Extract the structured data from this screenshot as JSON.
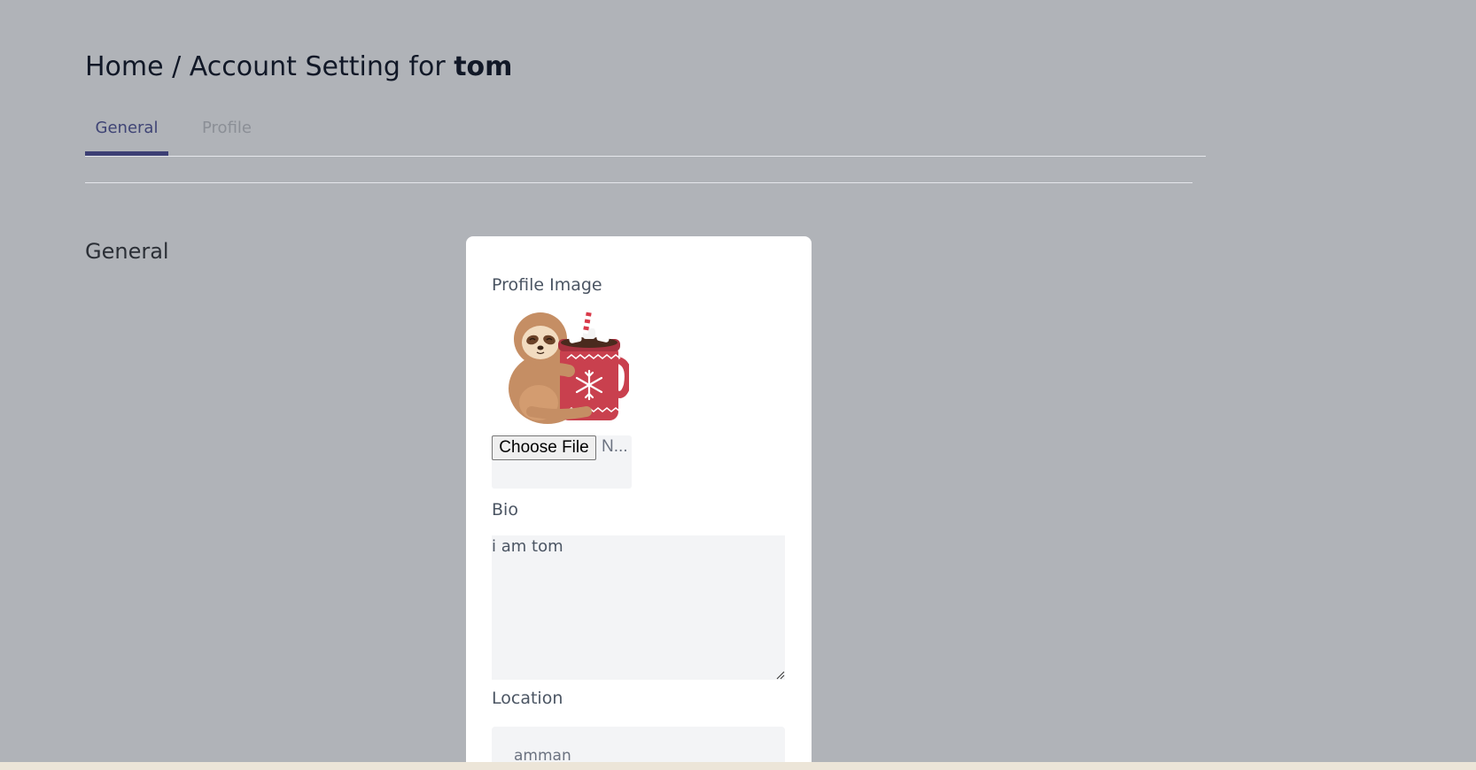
{
  "breadcrumb": {
    "home": "Home",
    "separator": "/",
    "prefix": "Account Setting for",
    "username": "tom"
  },
  "tabs": [
    {
      "label": "General",
      "active": true
    },
    {
      "label": "Profile",
      "active": false
    }
  ],
  "section": {
    "title": "General"
  },
  "form": {
    "profile_image_label": "Profile Image",
    "avatar_icon": "sloth-with-cocoa-mug-icon",
    "choose_file_label": "Choose File",
    "file_status": "N...",
    "bio_label": "Bio",
    "bio_value": "i am tom",
    "location_label": "Location",
    "location_value": "amman"
  },
  "colors": {
    "page_background": "#b0b3b8",
    "active_tab": "#3c3f74",
    "card": "#ffffff",
    "field": "#f3f4f6"
  }
}
